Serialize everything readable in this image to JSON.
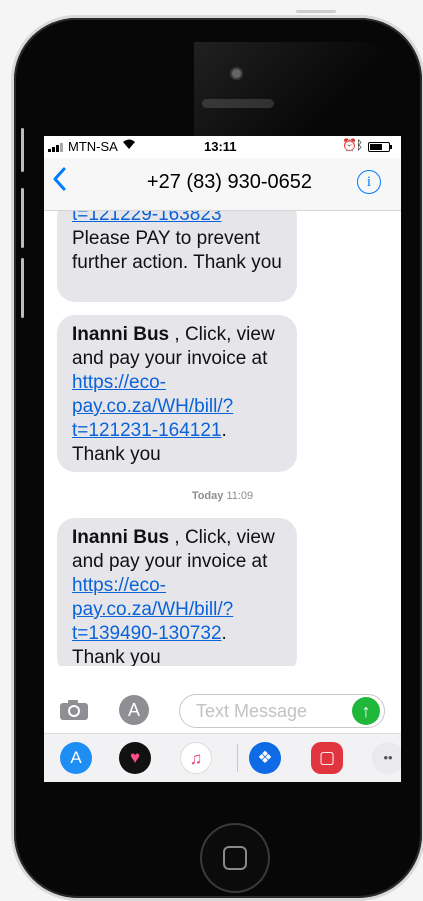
{
  "status_bar": {
    "carrier": "MTN-SA",
    "time": "13:11"
  },
  "nav": {
    "back_glyph": "<",
    "contact": "+27 (83) 930-0652",
    "info_glyph": "i"
  },
  "messages": [
    {
      "link": "t=121229-163823",
      "text_after": "Please PAY to prevent further action. Thank you"
    },
    {
      "sender": "Inanni Bus",
      "text_before": "  , Click, view and pay your invoice at ",
      "link": "https://eco-pay.co.za/WH/bill/?t=121231-164121",
      "link_parts": [
        "https://eco-pay.co.za/",
        "WH/bill/?",
        "t=121231-164121"
      ],
      "text_after": ". Thank you"
    },
    {
      "sender": "Inanni Bus",
      "text_before": "  , Click, view and pay your invoice at ",
      "link": "https://eco-pay.co.za/WH/bill/?t=139490-130732",
      "link_parts": [
        "https://eco-pay.co.za/",
        "WH/bill/?",
        "t=139490-130732"
      ],
      "text_after": ". Thank you"
    }
  ],
  "timestamp": {
    "day": "Today",
    "time": "11:09"
  },
  "input": {
    "placeholder": "Text Message",
    "send_glyph": "↑"
  },
  "app_drawer": [
    {
      "name": "app-store",
      "glyph": "A",
      "color": "#1e8ef5"
    },
    {
      "name": "digital-touch",
      "glyph": "♥",
      "color": "#111111"
    },
    {
      "name": "music",
      "glyph": "♫",
      "color": "#ffffff"
    },
    {
      "name": "dropbox",
      "glyph": "❖",
      "color": "#0f6ae6"
    },
    {
      "name": "card-app",
      "glyph": "▢",
      "color": "#e0343f"
    },
    {
      "name": "more",
      "glyph": "••",
      "color": "#e9e9ee"
    }
  ],
  "colors": {
    "link": "#0a63d8",
    "ios_blue": "#007aff",
    "bubble": "#e6e5ea",
    "send_green": "#1fb83b"
  }
}
